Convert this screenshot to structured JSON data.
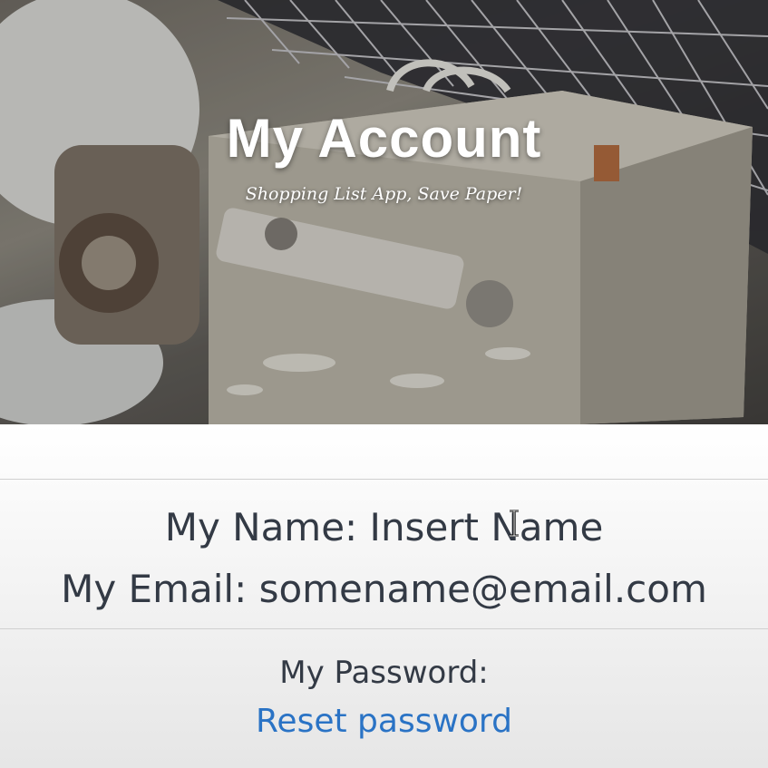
{
  "hero": {
    "title": "My Account",
    "subtitle": "Shopping List App, Save Paper!"
  },
  "profile": {
    "name_line": "My Name: Insert Name",
    "email_line": "My Email: somename@email.com"
  },
  "password": {
    "label": "My Password:",
    "reset_link": "Reset password"
  },
  "colors": {
    "text": "#333a45",
    "link": "#2a73c5",
    "hero_title": "#ffffff"
  },
  "icons": {
    "cursor": "text-cursor-icon"
  }
}
